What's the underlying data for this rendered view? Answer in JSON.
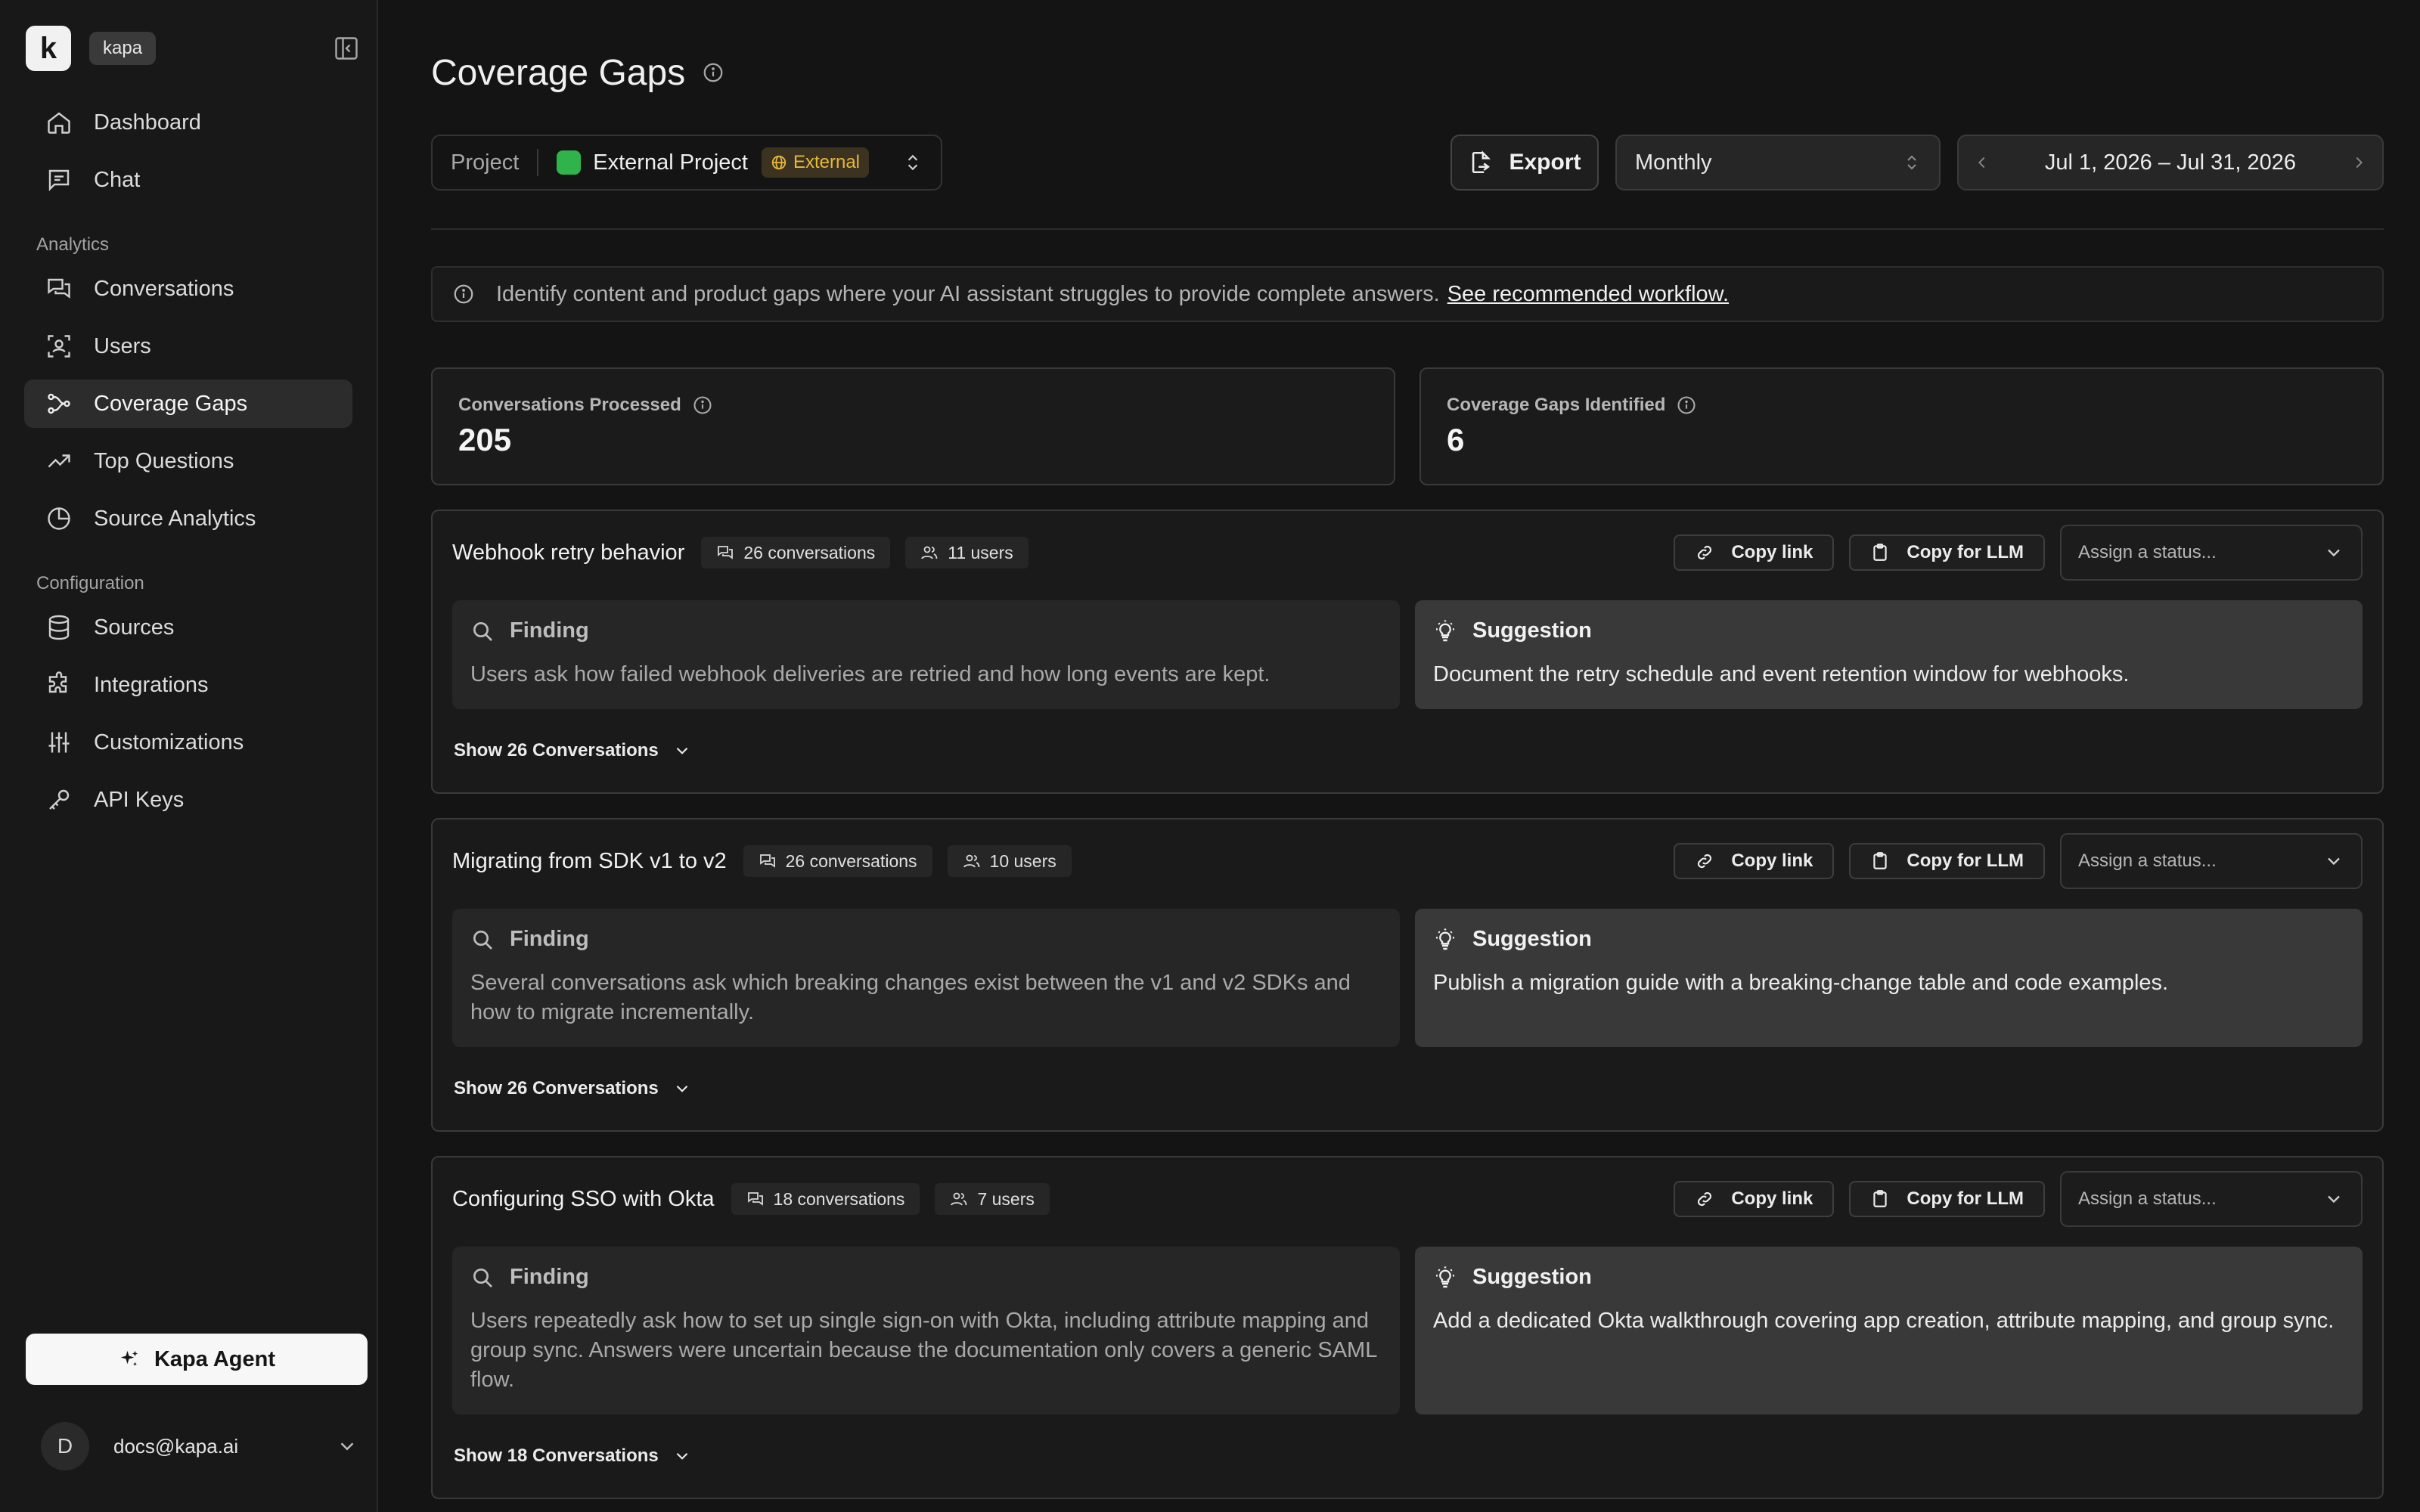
{
  "sidebar": {
    "org": "kapa",
    "logo_letter": "k",
    "nav_top": [
      {
        "label": "Dashboard",
        "icon": "home-icon"
      },
      {
        "label": "Chat",
        "icon": "chat-icon"
      }
    ],
    "section_analytics": "Analytics",
    "nav_analytics": [
      {
        "label": "Conversations",
        "icon": "conversations-icon"
      },
      {
        "label": "Users",
        "icon": "users-icon"
      },
      {
        "label": "Coverage Gaps",
        "icon": "coverage-gaps-icon",
        "active": true
      },
      {
        "label": "Top Questions",
        "icon": "trending-icon"
      },
      {
        "label": "Source Analytics",
        "icon": "pie-chart-icon"
      }
    ],
    "section_config": "Configuration",
    "nav_config": [
      {
        "label": "Sources",
        "icon": "database-icon"
      },
      {
        "label": "Integrations",
        "icon": "puzzle-icon"
      },
      {
        "label": "Customizations",
        "icon": "sliders-icon"
      },
      {
        "label": "API Keys",
        "icon": "key-icon"
      }
    ],
    "agent_button": "Kapa Agent",
    "user": {
      "initial": "D",
      "email": "docs@kapa.ai"
    }
  },
  "header": {
    "title": "Coverage Gaps"
  },
  "toolbar": {
    "project_label": "Project",
    "project_name": "External Project",
    "project_badge": "External",
    "export_label": "Export",
    "period": "Monthly",
    "date_range": "Jul 1, 2026 – Jul 31, 2026"
  },
  "banner": {
    "text": "Identify content and product gaps where your AI assistant struggles to provide complete answers.",
    "link": "See recommended workflow."
  },
  "stats": [
    {
      "label": "Conversations Processed",
      "value": "205"
    },
    {
      "label": "Coverage Gaps Identified",
      "value": "6"
    }
  ],
  "actions": {
    "copy_link": "Copy link",
    "copy_llm": "Copy for LLM",
    "status_placeholder": "Assign a status...",
    "finding_label": "Finding",
    "suggestion_label": "Suggestion"
  },
  "gaps": [
    {
      "title": "Webhook retry behavior",
      "conversations": "26 conversations",
      "users": "11 users",
      "finding": "Users ask how failed webhook deliveries are retried and how long events are kept.",
      "suggestion": "Document the retry schedule and event retention window for webhooks.",
      "show": "Show 26 Conversations"
    },
    {
      "title": "Migrating from SDK v1 to v2",
      "conversations": "26 conversations",
      "users": "10 users",
      "finding": "Several conversations ask which breaking changes exist between the v1 and v2 SDKs and how to migrate incrementally.",
      "suggestion": "Publish a migration guide with a breaking-change table and code examples.",
      "show": "Show 26 Conversations"
    },
    {
      "title": "Configuring SSO with Okta",
      "conversations": "18 conversations",
      "users": "7 users",
      "finding": "Users repeatedly ask how to set up single sign-on with Okta, including attribute mapping and group sync. Answers were uncertain because the documentation only covers a generic SAML flow.",
      "suggestion": "Add a dedicated Okta walkthrough covering app creation, attribute mapping, and group sync.",
      "show": "Show 18 Conversations"
    }
  ],
  "colors": {
    "background": "#141414",
    "sidebar": "#181818",
    "project_dot": "#2fb34a",
    "external_badge": "#e7b63f"
  }
}
